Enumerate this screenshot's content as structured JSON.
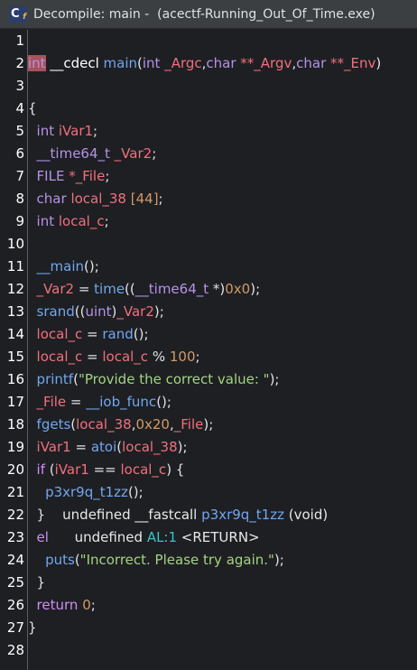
{
  "window": {
    "title": "Decompile: main -  (acectf-Running_Out_Of_Time.exe)",
    "icon": "decompiler-icon",
    "icon_letter": "C",
    "icon_sub": "f"
  },
  "line_numbers": [
    "1",
    "2",
    "3",
    "4",
    "5",
    "6",
    "7",
    "8",
    "9",
    "10",
    "11",
    "12",
    "13",
    "14",
    "15",
    "16",
    "17",
    "18",
    "19",
    "20",
    "21",
    "22",
    "23",
    "24",
    "25",
    "26",
    "27",
    "28"
  ],
  "code": {
    "l2": {
      "int": "int",
      "cdecl": " __cdecl ",
      "main": "main",
      "p1": "(",
      "int2": "int",
      "argc": " _Argc",
      "comma1": ",",
      "char1": "char",
      "argv": " **_Argv",
      "comma2": ",",
      "char2": "char",
      "env": " **_Env",
      "p2": ")"
    },
    "l4": "{",
    "l5": {
      "type": "int",
      "var": " iVar1",
      "end": ";"
    },
    "l6": {
      "type": "__time64_t",
      "var": " _Var2",
      "end": ";"
    },
    "l7": {
      "type": "FILE",
      "var": " *_File",
      "end": ";"
    },
    "l8": {
      "type": "char",
      "var": " local_38 ",
      "arr": "[44]",
      "end": ";"
    },
    "l9": {
      "type": "int",
      "var": " local_c",
      "end": ";"
    },
    "l11": {
      "fn": "__main",
      "end": "();"
    },
    "l12": {
      "var": "_Var2",
      "eq": " = ",
      "fn": "time",
      "p": "((",
      "type": "__time64_t",
      "cast": " *)",
      "num": "0x0",
      "end": ");"
    },
    "l13": {
      "fn": "srand",
      "p": "((",
      "type": "uint",
      "p2": ")",
      "var": "_Var2",
      "end": ");"
    },
    "l14": {
      "var": "local_c",
      "eq": " = ",
      "fn": "rand",
      "end": "();"
    },
    "l15": {
      "var": "local_c",
      "eq": " = ",
      "var2": "local_c",
      "op": " % ",
      "num": "100",
      "end": ";"
    },
    "l16": {
      "fn": "printf",
      "p": "(",
      "str": "\"Provide the correct value: \"",
      "end": ");"
    },
    "l17": {
      "var": "_File",
      "eq": " = ",
      "fn": "__iob_func",
      "end": "();"
    },
    "l18": {
      "fn": "fgets",
      "p": "(",
      "var": "local_38",
      "c1": ",",
      "num": "0x20",
      "c2": ",",
      "var2": "_File",
      "end": ");"
    },
    "l19": {
      "var": "iVar1",
      "eq": " = ",
      "fn": "atoi",
      "p": "(",
      "var2": "local_38",
      "end": ");"
    },
    "l20": {
      "kw": "if",
      "p": " (",
      "var": "iVar1",
      "op": " == ",
      "var2": "local_c",
      "end": ") {"
    },
    "l21": {
      "fn": "p3xr9q_t1zz",
      "end": "();"
    },
    "l22": {
      "brace": "}",
      "tip_a": "undefined __fastcall ",
      "tip_fn": "p3xr9q_t1zz",
      "tip_b": " (void)"
    },
    "l23": {
      "kw": "el",
      "tip_a": "undefined ",
      "tip_reg": "AL:1",
      "tip_b": " <RETURN>"
    },
    "l24": {
      "fn": "puts",
      "p": "(",
      "str": "\"Incorrect. Please try again.\"",
      "end": ");"
    },
    "l25": "}",
    "l26": {
      "kw": "return",
      "num": " 0",
      "end": ";"
    },
    "l27": "}"
  },
  "colors": {
    "background": "#1e1f22",
    "keyword": "#cf8ef4",
    "type": "#b592e8",
    "function": "#71a7f0",
    "variable": "#f0707e",
    "number": "#d19a66",
    "string": "#a3d383",
    "cursor_highlight": "#a8535a"
  }
}
